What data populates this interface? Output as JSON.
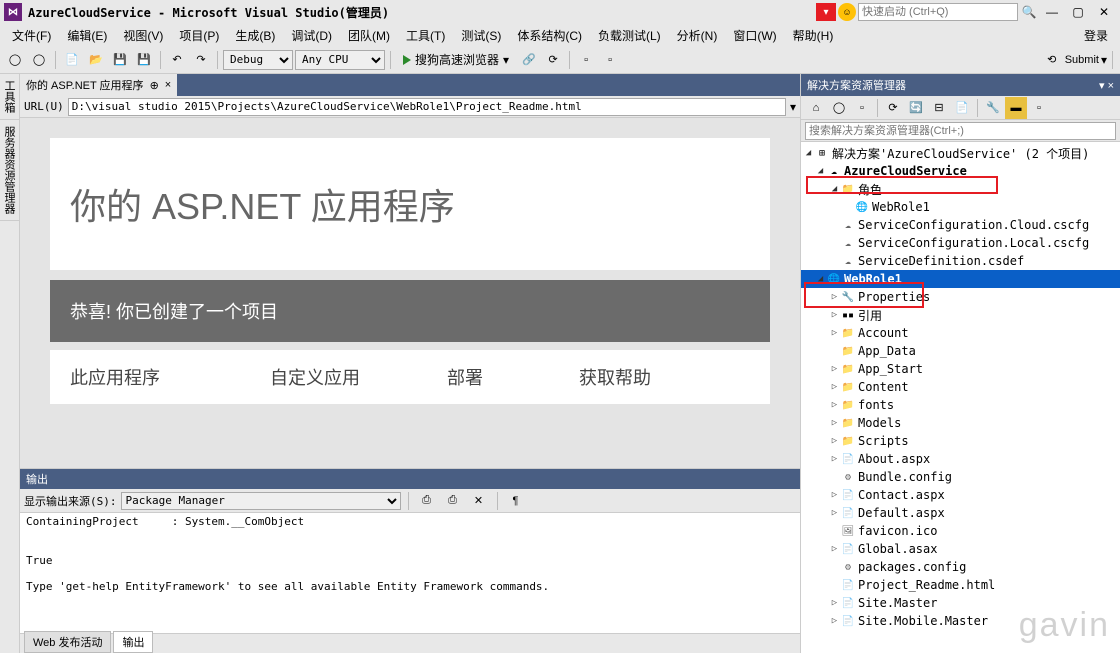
{
  "title": "AzureCloudService - Microsoft Visual Studio(管理员)",
  "quick_launch_placeholder": "快速启动 (Ctrl+Q)",
  "login": "登录",
  "menu": [
    "文件(F)",
    "编辑(E)",
    "视图(V)",
    "项目(P)",
    "生成(B)",
    "调试(D)",
    "团队(M)",
    "工具(T)",
    "测试(S)",
    "体系结构(C)",
    "负载测试(L)",
    "分析(N)",
    "窗口(W)",
    "帮助(H)"
  ],
  "toolbar": {
    "config": "Debug",
    "platform": "Any CPU",
    "run_label": "搜狗高速浏览器",
    "submit_label": "Submit"
  },
  "doc_tab": {
    "label": "你的 ASP.NET 应用程序",
    "pinned": "⊕",
    "close": "×"
  },
  "urlbar": {
    "label": "URL(U)",
    "value": "D:\\visual studio 2015\\Projects\\AzureCloudService\\WebRole1\\Project_Readme.html"
  },
  "asp": {
    "title_prefix": "你的 ",
    "title_main": "ASP.NET 应用程序",
    "congrats": "恭喜! 你已创建了一个项目",
    "section_app": "此应用程序",
    "section_custom": "自定义应用",
    "section_deploy": "部署",
    "section_help": "获取帮助"
  },
  "left_tabs": [
    "工具箱",
    "服务器资源管理器"
  ],
  "output": {
    "title": "输出",
    "source_label": "显示输出来源(S):",
    "source_value": "Package Manager",
    "text": "ContainingProject     : System.__ComObject\n\n\nTrue\n\nType 'get-help EntityFramework' to see all available Entity Framework commands."
  },
  "bottom_tabs": {
    "web_publish": "Web 发布活动",
    "output": "输出"
  },
  "solution_explorer": {
    "title": "解决方案资源管理器",
    "search_placeholder": "搜索解决方案资源管理器(Ctrl+;)",
    "tree": {
      "solution": "解决方案'AzureCloudService' (2 个项目)",
      "proj_cloud": "AzureCloudService",
      "roles": "角色",
      "webrole_role": "WebRole1",
      "svc_cfg_cloud": "ServiceConfiguration.Cloud.cscfg",
      "svc_cfg_local": "ServiceConfiguration.Local.cscfg",
      "svc_def": "ServiceDefinition.csdef",
      "proj_web": "WebRole1",
      "properties": "Properties",
      "references": "引用",
      "account": "Account",
      "app_data": "App_Data",
      "app_start": "App_Start",
      "content": "Content",
      "fonts": "fonts",
      "models": "Models",
      "scripts": "Scripts",
      "about_aspx": "About.aspx",
      "bundle_config": "Bundle.config",
      "contact_aspx": "Contact.aspx",
      "default_aspx": "Default.aspx",
      "favicon_ico": "favicon.ico",
      "global_asax": "Global.asax",
      "packages_config": "packages.config",
      "project_readme": "Project_Readme.html",
      "site_master": "Site.Master",
      "site_mobile": "Site.Mobile.Master"
    }
  },
  "watermark": "gavin"
}
